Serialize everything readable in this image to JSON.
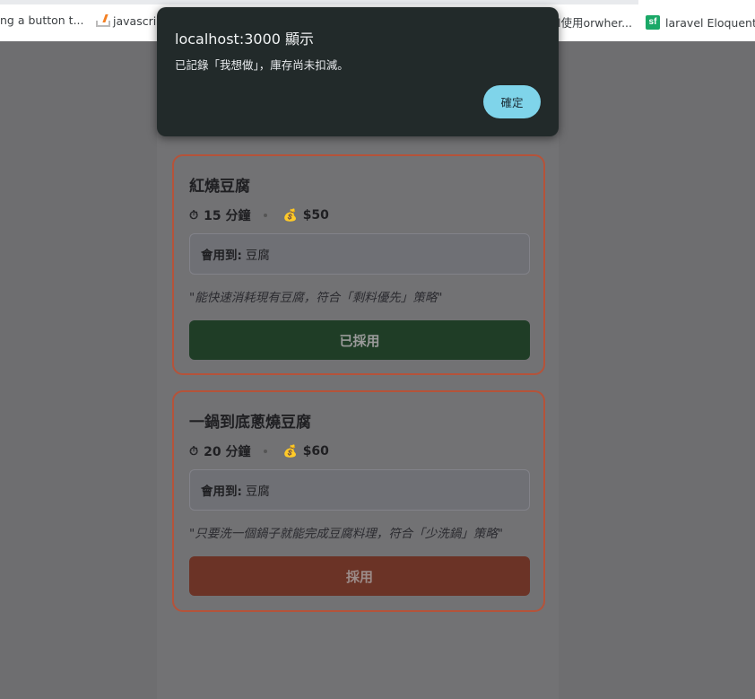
{
  "bookmarks": [
    {
      "label": "ng a button t...",
      "icon": "none"
    },
    {
      "label": "javascrip",
      "icon": "stackoverflow-icon"
    },
    {
      "label": "l使用orwher...",
      "icon": "none"
    },
    {
      "label": "laravel Eloquent如",
      "icon": "sf-icon"
    }
  ],
  "recipes": [
    {
      "title": "紅燒豆腐",
      "time": "15 分鐘",
      "price": "$50",
      "uses_label": "會用到:",
      "uses_value": "豆腐",
      "reason": "\"能快速消耗現有豆腐，符合「剩料優先」策略\"",
      "button_label": "已採用",
      "time_icon": "stopwatch-icon",
      "price_icon": "money-bag-icon"
    },
    {
      "title": "一鍋到底蔥燒豆腐",
      "time": "20 分鐘",
      "price": "$60",
      "uses_label": "會用到:",
      "uses_value": "豆腐",
      "reason": "\"只要洗一個鍋子就能完成豆腐料理，符合「少洗鍋」策略\"",
      "button_label": "採用",
      "time_icon": "stopwatch-icon",
      "price_icon": "money-bag-icon"
    }
  ],
  "dialog": {
    "title": "localhost:3000 顯示",
    "message": "已記錄「我想做」，庫存尚未扣減。",
    "ok_label": "確定"
  },
  "colors": {
    "accent_border": "#b5533a",
    "adopted_button": "#1f3d26",
    "adopt_button": "#6b3326",
    "dialog_bg": "#222a2a",
    "dialog_ok": "#7fd4ea"
  }
}
